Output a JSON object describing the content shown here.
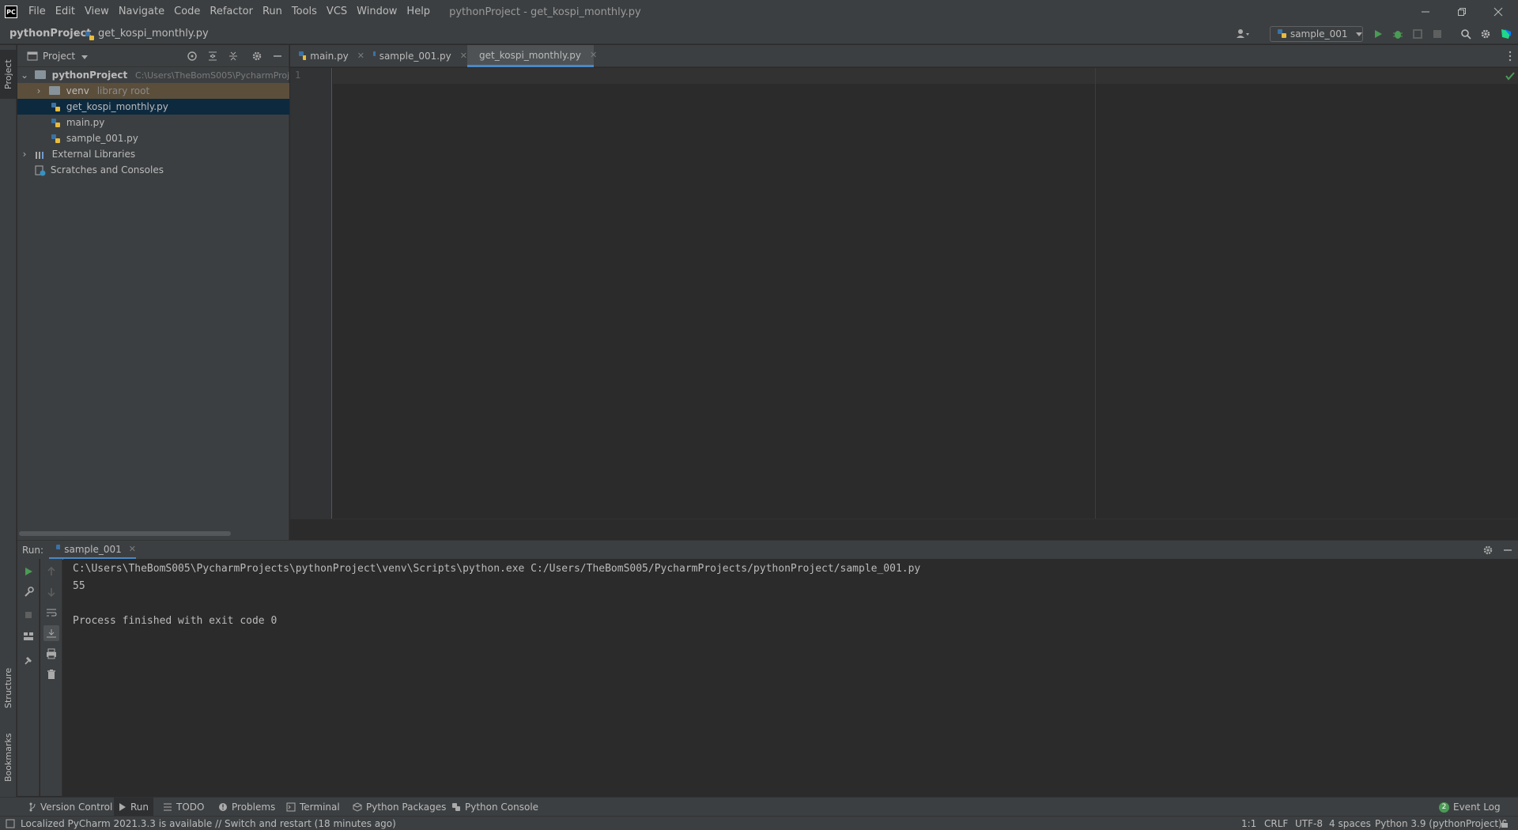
{
  "menu": {
    "items": [
      "File",
      "Edit",
      "View",
      "Navigate",
      "Code",
      "Refactor",
      "Run",
      "Tools",
      "VCS",
      "Window",
      "Help"
    ],
    "window_title": "pythonProject - get_kospi_monthly.py",
    "logo_text": "PC"
  },
  "navbar": {
    "project": "pythonProject",
    "file": "get_kospi_monthly.py",
    "run_config": "sample_001"
  },
  "project_panel": {
    "title": "Project",
    "tree": {
      "root_name": "pythonProject",
      "root_path": "C:\\Users\\TheBomS005\\PycharmProjec",
      "venv_name": "venv",
      "venv_hint": "library root",
      "files": [
        "get_kospi_monthly.py",
        "main.py",
        "sample_001.py"
      ],
      "external": "External Libraries",
      "scratches": "Scratches and Consoles"
    }
  },
  "left_stripe": {
    "project": "Project",
    "structure": "Structure",
    "bookmarks": "Bookmarks"
  },
  "editor": {
    "tabs": [
      "main.py",
      "sample_001.py",
      "get_kospi_monthly.py"
    ],
    "active_tab": "get_kospi_monthly.py",
    "line_number": "1"
  },
  "run_panel": {
    "label": "Run:",
    "tab": "sample_001",
    "output": [
      "C:\\Users\\TheBomS005\\PycharmProjects\\pythonProject\\venv\\Scripts\\python.exe C:/Users/TheBomS005/PycharmProjects/pythonProject/sample_001.py",
      "55",
      "",
      "Process finished with exit code 0"
    ]
  },
  "bottom_tools": {
    "version_control": "Version Control",
    "run": "Run",
    "todo": "TODO",
    "problems": "Problems",
    "terminal": "Terminal",
    "python_packages": "Python Packages",
    "python_console": "Python Console",
    "event_log": "Event Log",
    "event_log_count": "2"
  },
  "status": {
    "message": "Localized PyCharm 2021.3.3 is available // Switch and restart (18 minutes ago)",
    "position": "1:1",
    "line_sep": "CRLF",
    "encoding": "UTF-8",
    "indent": "4 spaces",
    "interpreter": "Python 3.9 (pythonProject)"
  },
  "colors": {
    "accent": "#4a88c7",
    "run_green": "#499c54",
    "selected_row": "#0d293e",
    "venv_row": "#5b4e3b"
  }
}
